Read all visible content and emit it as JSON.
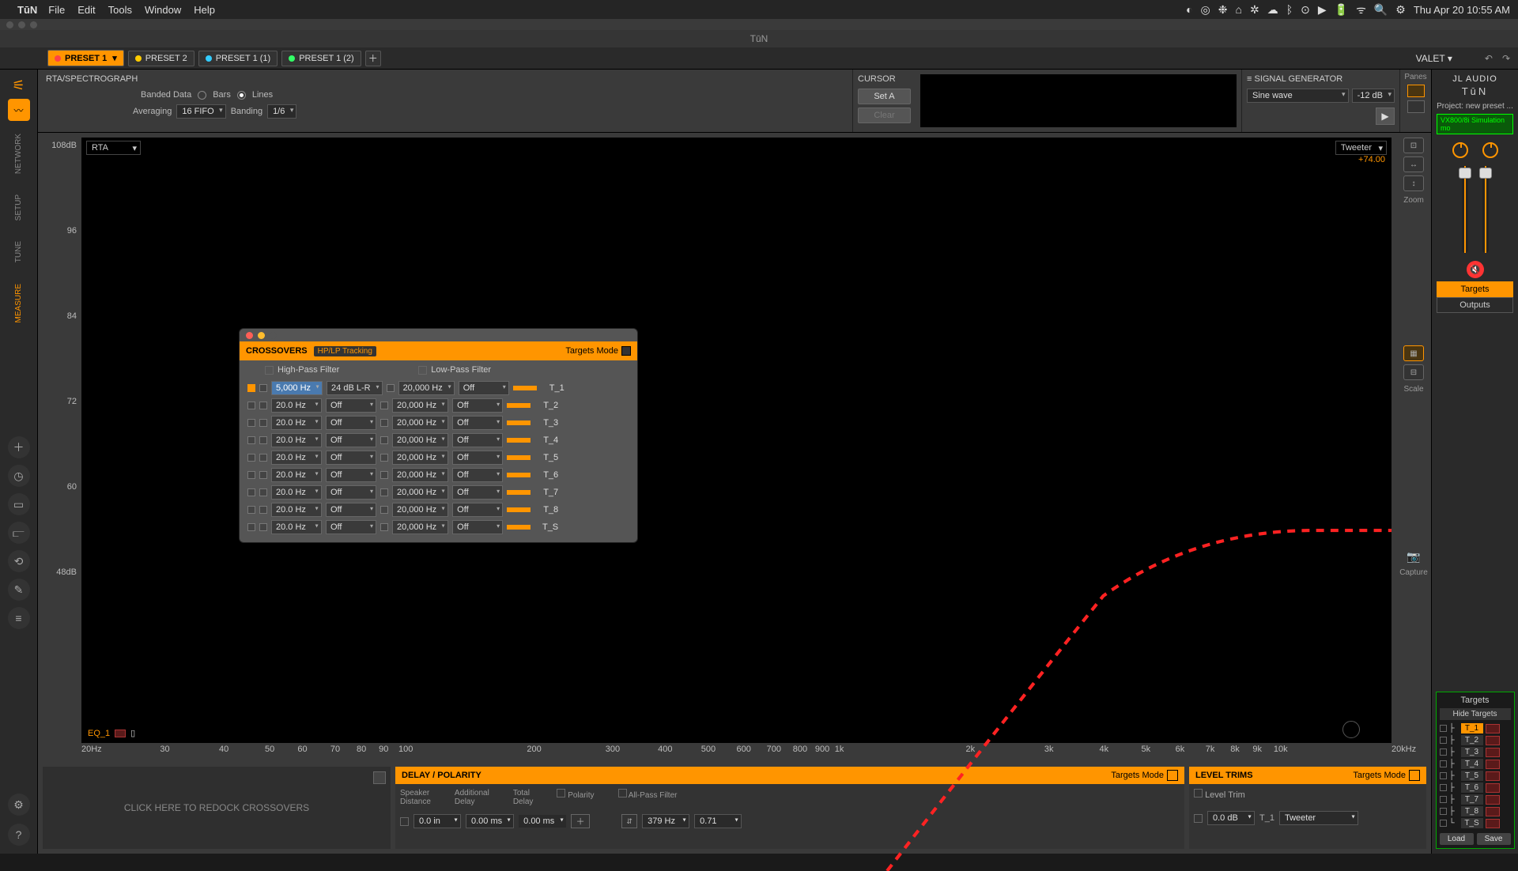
{
  "menubar": {
    "app": "TūN",
    "items": [
      "File",
      "Edit",
      "Tools",
      "Window",
      "Help"
    ],
    "clock": "Thu Apr 20  10:55 AM"
  },
  "titlebar": "TūN",
  "tabs": [
    {
      "label": "PRESET 1",
      "color": "#ff4444",
      "active": true,
      "drop": true
    },
    {
      "label": "PRESET 2",
      "color": "#ffcc00"
    },
    {
      "label": "PRESET 1 (1)",
      "color": "#33ccff"
    },
    {
      "label": "PRESET 1 (2)",
      "color": "#33ff66"
    }
  ],
  "valet": "VALET ▾",
  "left_tabs": [
    "NETWORK",
    "SETUP",
    "TUNE",
    "MEASURE"
  ],
  "rta": {
    "label": "RTA/SPECTROGRAPH",
    "banded": "Banded Data",
    "bars": "Bars",
    "lines": "Lines",
    "avg_label": "Averaging",
    "avg": "16 FIFO",
    "banding_label": "Banding",
    "banding": "1/6"
  },
  "cursor": {
    "label": "CURSOR",
    "seta": "Set A",
    "clear": "Clear"
  },
  "siggen": {
    "label": "SIGNAL GENERATOR",
    "hamburger": "≡",
    "wave": "Sine wave",
    "level": "-12 dB"
  },
  "panes": "Panes",
  "plot": {
    "mode": "RTA",
    "channel": "Tweeter",
    "gain": "+74.00",
    "eq": "EQ_1"
  },
  "yticks": [
    "108dB",
    "96",
    "84",
    "72",
    "60",
    "48dB"
  ],
  "xticks": [
    {
      "l": "20Hz",
      "p": 0
    },
    {
      "l": "30",
      "p": 6
    },
    {
      "l": "40",
      "p": 10.5
    },
    {
      "l": "50",
      "p": 14
    },
    {
      "l": "60",
      "p": 16.5
    },
    {
      "l": "70",
      "p": 19
    },
    {
      "l": "80",
      "p": 21
    },
    {
      "l": "90",
      "p": 22.7
    },
    {
      "l": "100",
      "p": 24.2
    },
    {
      "l": "200",
      "p": 34
    },
    {
      "l": "300",
      "p": 40
    },
    {
      "l": "400",
      "p": 44
    },
    {
      "l": "500",
      "p": 47.3
    },
    {
      "l": "600",
      "p": 50
    },
    {
      "l": "700",
      "p": 52.3
    },
    {
      "l": "800",
      "p": 54.3
    },
    {
      "l": "900",
      "p": 56
    },
    {
      "l": "1k",
      "p": 57.5
    },
    {
      "l": "2k",
      "p": 67.5
    },
    {
      "l": "3k",
      "p": 73.5
    },
    {
      "l": "4k",
      "p": 77.7
    },
    {
      "l": "5k",
      "p": 80.9
    },
    {
      "l": "6k",
      "p": 83.5
    },
    {
      "l": "7k",
      "p": 85.8
    },
    {
      "l": "8k",
      "p": 87.7
    },
    {
      "l": "9k",
      "p": 89.4
    },
    {
      "l": "10k",
      "p": 91
    },
    {
      "l": "20kHz",
      "p": 100
    }
  ],
  "zoom": "Zoom",
  "scale": "Scale",
  "capture": "Capture",
  "redock": "CLICK HERE TO REDOCK CROSSOVERS",
  "delay": {
    "title": "DELAY / POLARITY",
    "tm": "Targets Mode",
    "cols": [
      "Speaker\nDistance",
      "Additional\nDelay",
      "Total\nDelay",
      "Polarity",
      "All-Pass Filter"
    ],
    "dist": "0.0 in",
    "add": "0.00 ms",
    "tot": "0.00 ms",
    "apf_f": "379 Hz",
    "apf_q": "0.71"
  },
  "level": {
    "title": "LEVEL TRIMS",
    "tm": "Targets Mode",
    "col": "Level Trim",
    "val": "0.0 dB",
    "t": "T_1",
    "ch": "Tweeter"
  },
  "right": {
    "brand": "JL AUDIO",
    "brand2": "TūN",
    "proj": "Project: new preset ...",
    "sim": "VX800/8i Simulation mo",
    "targets_btn": "Targets",
    "outputs_btn": "Outputs",
    "tp_title": "Targets",
    "hide": "Hide Targets",
    "rows": [
      "T_1",
      "T_2",
      "T_3",
      "T_4",
      "T_5",
      "T_6",
      "T_7",
      "T_8",
      "T_S"
    ],
    "load": "Load",
    "save": "Save"
  },
  "xover": {
    "title": "CROSSOVERS",
    "badge": "HP/LP Tracking",
    "tm": "Targets Mode",
    "hp": "High-Pass Filter",
    "lp": "Low-Pass Filter",
    "rows": [
      {
        "hp_f": "5,000 Hz",
        "hp_s": "24 dB L-R",
        "lp_f": "20,000 Hz",
        "lp_s": "Off",
        "t": "T_1",
        "sel": true
      },
      {
        "hp_f": "20.0 Hz",
        "hp_s": "Off",
        "lp_f": "20,000 Hz",
        "lp_s": "Off",
        "t": "T_2"
      },
      {
        "hp_f": "20.0 Hz",
        "hp_s": "Off",
        "lp_f": "20,000 Hz",
        "lp_s": "Off",
        "t": "T_3"
      },
      {
        "hp_f": "20.0 Hz",
        "hp_s": "Off",
        "lp_f": "20,000 Hz",
        "lp_s": "Off",
        "t": "T_4"
      },
      {
        "hp_f": "20.0 Hz",
        "hp_s": "Off",
        "lp_f": "20,000 Hz",
        "lp_s": "Off",
        "t": "T_5"
      },
      {
        "hp_f": "20.0 Hz",
        "hp_s": "Off",
        "lp_f": "20,000 Hz",
        "lp_s": "Off",
        "t": "T_6"
      },
      {
        "hp_f": "20.0 Hz",
        "hp_s": "Off",
        "lp_f": "20,000 Hz",
        "lp_s": "Off",
        "t": "T_7"
      },
      {
        "hp_f": "20.0 Hz",
        "hp_s": "Off",
        "lp_f": "20,000 Hz",
        "lp_s": "Off",
        "t": "T_8"
      },
      {
        "hp_f": "20.0 Hz",
        "hp_s": "Off",
        "lp_f": "20,000 Hz",
        "lp_s": "Off",
        "t": "T_S"
      }
    ]
  }
}
